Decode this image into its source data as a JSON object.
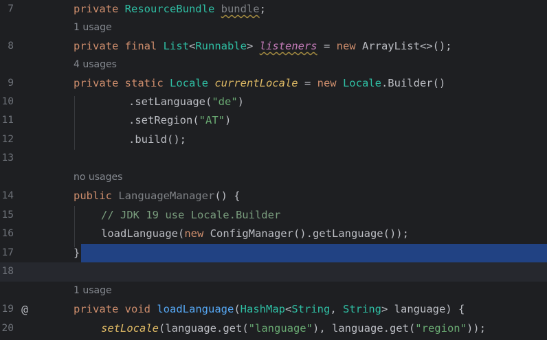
{
  "editor": {
    "lines": [
      {
        "n": "7",
        "code": "private ResourceBundle bundle;"
      },
      {
        "hint": "1 usage"
      },
      {
        "n": "8",
        "code": "private final List<Runnable> listeners = new ArrayList<>();"
      },
      {
        "hint": "4 usages"
      },
      {
        "n": "9",
        "code": "private static Locale currentLocale = new Locale.Builder()"
      },
      {
        "n": "10",
        "code": ".setLanguage(\"de\")"
      },
      {
        "n": "11",
        "code": ".setRegion(\"AT\")"
      },
      {
        "n": "12",
        "code": ".build();"
      },
      {
        "n": "13",
        "code": ""
      },
      {
        "hint": "no usages"
      },
      {
        "n": "14",
        "code": "public LanguageManager() {"
      },
      {
        "n": "15",
        "code": "// JDK 19 use Locale.Builder"
      },
      {
        "n": "16",
        "code": "loadLanguage(new ConfigManager().getLanguage());"
      },
      {
        "n": "17",
        "code": "}"
      },
      {
        "n": "18",
        "code": ""
      },
      {
        "hint": "1 usage"
      },
      {
        "n": "19",
        "code": "private void loadLanguage(HashMap<String, String> language) {",
        "gutter_icon": "@"
      },
      {
        "n": "20",
        "code": "setLocale(language.get(\"language\"), language.get(\"region\"));"
      }
    ]
  },
  "colors": {
    "background": "#1e1f22",
    "keyword": "#cf8e6d",
    "type": "#2fbfa4",
    "field": "#c77dbb",
    "string": "#6aab73",
    "method": "#56a8f5",
    "comment": "#7a9e7e",
    "selection": "#214283"
  }
}
